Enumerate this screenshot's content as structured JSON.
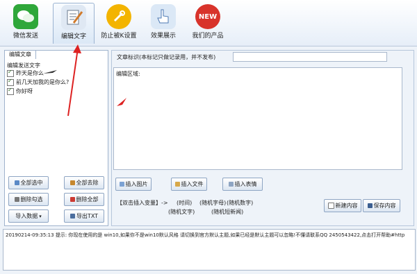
{
  "toolbar": {
    "items": [
      {
        "label": "微信发送",
        "icon": "wechat-icon"
      },
      {
        "label": "编辑文字",
        "icon": "edit-text-icon"
      },
      {
        "label": "防止被K设置",
        "icon": "wrench-icon"
      },
      {
        "label": "效果展示",
        "icon": "pointer-hand-icon"
      },
      {
        "label": "我们的产品",
        "icon": "new-badge-icon",
        "badge": "NEW"
      }
    ],
    "colors": {
      "wechat": "#2fa73a",
      "wrench": "#f3b400",
      "new": "#d8332b"
    }
  },
  "left": {
    "tab_label": "编辑文章",
    "group_title": "编辑发送文字",
    "items": [
      {
        "label": "昨天是你么",
        "checked": true
      },
      {
        "label": "前几天加我的是你么?",
        "checked": true
      },
      {
        "label": "你好呀",
        "checked": true
      }
    ],
    "buttons": {
      "select_all": "全部选中",
      "deselect_all": "全部去除",
      "delete_checked": "删除勾选",
      "delete_all": "删除全部",
      "import": "导入数据",
      "export": "导出TXT"
    }
  },
  "right": {
    "title_label": "文章标识(本标记只做记录用，并不发布)",
    "title_value": "",
    "edit_label": "编辑区域:",
    "buttons": {
      "insert_image": "插入图片",
      "insert_file": "插入文件",
      "insert_emoji": "插入表情",
      "new_content": "新建内容",
      "save_content": "保存内容"
    },
    "vars_label": "【双击插入变量】->",
    "vars": [
      "(时间)",
      "(随机字母)",
      "(随机数字)",
      "(随机文字)",
      "(随机短新闻)"
    ]
  },
  "status": {
    "text": "20190214-09:35:13  提示: 你现在使用的是 win10,如果你不是win10默认风格 请切换到官方默认主题,如果已经是默认主题可以忽略!不懂请联系QQ 2450543422,点击打开帮助#http"
  }
}
